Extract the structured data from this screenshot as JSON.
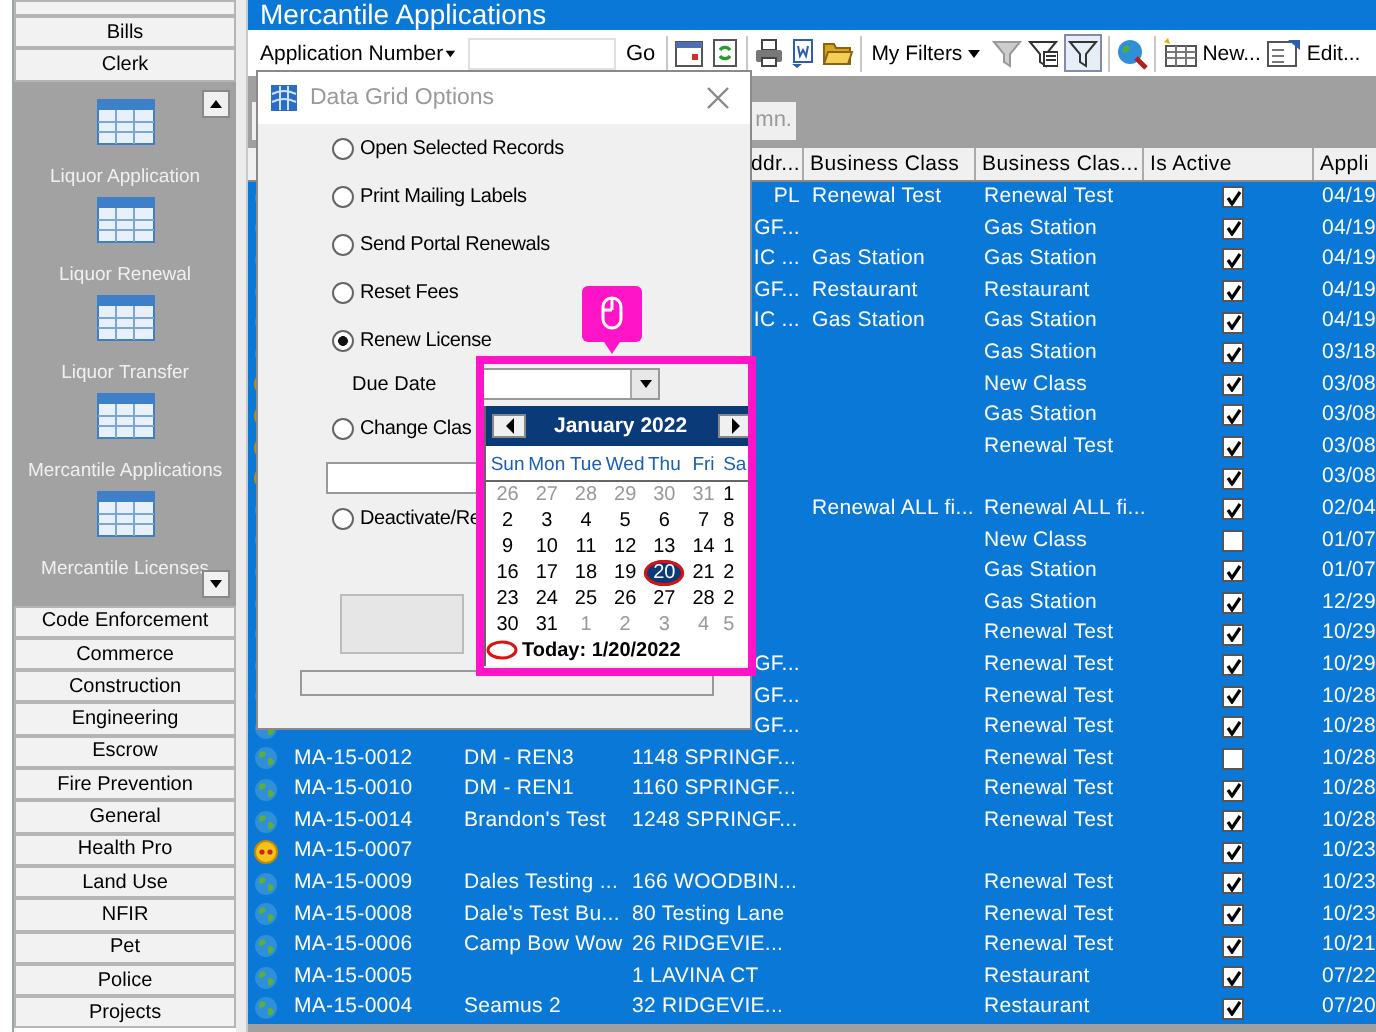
{
  "sidebar": {
    "top_buttons": [
      "Bills",
      "Clerk"
    ],
    "panel_items": [
      {
        "label": "Liquor Application"
      },
      {
        "label": "Liquor Renewal"
      },
      {
        "label": "Liquor Transfer"
      },
      {
        "label": "Mercantile Applications"
      },
      {
        "label": "Mercantile Licenses"
      }
    ],
    "bottom_buttons": [
      "Code Enforcement",
      "Commerce",
      "Construction",
      "Engineering",
      "Escrow",
      "Fire Prevention",
      "General",
      "Health Pro",
      "Land Use",
      "NFIR",
      "Pet",
      "Police",
      "Projects"
    ]
  },
  "title": "Mercantile Applications",
  "toolbar": {
    "field_selector": "Application Number",
    "go": "Go",
    "filters": "My Filters",
    "new": "New...",
    "edit": "Edit..."
  },
  "grid": {
    "group_panel": "mn.",
    "columns": [
      "ddr...",
      "Business Class",
      "Business Clas...",
      "Is Active",
      "Appli"
    ],
    "rows": [
      {
        "kind": "globe",
        "selected": true,
        "address": "PL",
        "class": "Renewal Test",
        "class_2": "Renewal Test",
        "active": true,
        "applied": "04/19"
      },
      {
        "kind": "globe",
        "selected": true,
        "address": "GF...",
        "class_2": "Gas Station",
        "active": true,
        "applied": "04/19"
      },
      {
        "kind": "globe",
        "selected": true,
        "address": "IC ...",
        "class": "Gas Station",
        "class_2": "Gas Station",
        "active": true,
        "applied": "04/19"
      },
      {
        "kind": "globe",
        "selected": true,
        "address": "GF...",
        "class": "Restaurant",
        "class_2": "Restaurant",
        "active": true,
        "applied": "04/19"
      },
      {
        "kind": "globe",
        "selected": true,
        "address": "IC ...",
        "class": "Gas Station",
        "class_2": "Gas Station",
        "active": true,
        "applied": "04/19"
      },
      {
        "kind": "globe",
        "selected": true,
        "class_2": "Gas Station",
        "active": true,
        "applied": "03/18"
      },
      {
        "kind": "alert",
        "selected": true,
        "class_2": "New Class",
        "active": true,
        "applied": "03/08"
      },
      {
        "kind": "alert",
        "selected": true,
        "class_2": "Gas Station",
        "active": true,
        "applied": "03/08"
      },
      {
        "kind": "alert",
        "selected": true,
        "class_2": "Renewal Test",
        "active": true,
        "applied": "03/08"
      },
      {
        "kind": "alert",
        "selected": true,
        "active": true,
        "applied": "03/08"
      },
      {
        "kind": "globe",
        "selected": true,
        "class": "Renewal ALL fi...",
        "class_2": "Renewal ALL fi...",
        "active": true,
        "applied": "02/04"
      },
      {
        "kind": "globe",
        "selected": true,
        "class_2": "New Class",
        "active": false,
        "applied": "01/07"
      },
      {
        "kind": "globe",
        "selected": true,
        "class_2": "Gas Station",
        "active": true,
        "applied": "01/07"
      },
      {
        "kind": "globe",
        "selected": true,
        "class_2": "Gas Station",
        "active": true,
        "applied": "12/29"
      },
      {
        "kind": "globe",
        "selected": true,
        "class_2": "Renewal Test",
        "active": true,
        "applied": "10/29"
      },
      {
        "kind": "globe",
        "selected": true,
        "address": "GF...",
        "class_2": "Renewal Test",
        "active": true,
        "applied": "10/29"
      },
      {
        "kind": "globe",
        "selected": true,
        "address": "GF...",
        "class_2": "Renewal Test",
        "active": true,
        "applied": "10/28"
      },
      {
        "kind": "globe",
        "selected": true,
        "address": "GF...",
        "class_2": "Renewal Test",
        "active": true,
        "applied": "10/28"
      },
      {
        "kind": "globe",
        "selected": true,
        "app_number": "MA-15-0012",
        "name": "DM - REN3",
        "address": "1148 SPRINGF...",
        "class_2": "Renewal Test",
        "active": false,
        "applied": "10/28"
      },
      {
        "kind": "globe",
        "selected": true,
        "app_number": "MA-15-0010",
        "name": "DM - REN1",
        "address": "1160 SPRINGF...",
        "class_2": "Renewal Test",
        "active": true,
        "applied": "10/28"
      },
      {
        "kind": "globe",
        "selected": true,
        "app_number": "MA-15-0014",
        "name": "Brandon's Test",
        "address": "1248 SPRINGF...",
        "class_2": "Renewal Test",
        "active": true,
        "applied": "10/28"
      },
      {
        "kind": "alert",
        "selected": true,
        "app_number": "MA-15-0007",
        "active": true,
        "applied": "10/23"
      },
      {
        "kind": "globe",
        "selected": true,
        "app_number": "MA-15-0009",
        "name": "Dales Testing ...",
        "address": "166 WOODBIN...",
        "class_2": "Renewal Test",
        "active": true,
        "applied": "10/23"
      },
      {
        "kind": "globe",
        "selected": true,
        "app_number": "MA-15-0008",
        "name": "Dale's Test Bu...",
        "address": "80 Testing Lane",
        "class_2": "Renewal Test",
        "active": true,
        "applied": "10/23"
      },
      {
        "kind": "globe",
        "selected": true,
        "app_number": "MA-15-0006",
        "name": "Camp Bow Wow",
        "address": "26 RIDGEVIE...",
        "class_2": "Renewal Test",
        "active": true,
        "applied": "10/21"
      },
      {
        "kind": "globe",
        "selected": true,
        "app_number": "MA-15-0005",
        "address": "1 LAVINA CT",
        "class_2": "Restaurant",
        "active": true,
        "applied": "07/22"
      },
      {
        "kind": "globe",
        "selected": true,
        "app_number": "MA-15-0004",
        "name": "Seamus 2",
        "address": "32 RIDGEVIE...",
        "class_2": "Restaurant",
        "active": true,
        "applied": "07/20"
      }
    ]
  },
  "dialog": {
    "title": "Data Grid Options",
    "options": [
      {
        "kind": "radio",
        "label": "Open Selected Records",
        "selected": false
      },
      {
        "kind": "radio",
        "label": "Print Mailing Labels",
        "selected": false
      },
      {
        "kind": "radio",
        "label": "Send Portal Renewals",
        "selected": false
      },
      {
        "kind": "radio",
        "label": "Reset Fees",
        "selected": false
      },
      {
        "kind": "radio",
        "label": "Renew License",
        "selected": true
      },
      {
        "kind": "date",
        "label": "Due Date"
      },
      {
        "kind": "radio",
        "label": "Change Clas",
        "selected": false
      },
      {
        "kind": "text"
      },
      {
        "kind": "radio",
        "label": "Deactivate/Re",
        "selected": false
      },
      {
        "kind": "button"
      },
      {
        "kind": "status"
      }
    ]
  },
  "calendar": {
    "month": "January 2022",
    "weekdays": [
      "Sun",
      "Mon",
      "Tue",
      "Wed",
      "Thu",
      "Fri",
      "Sa"
    ],
    "weeks": [
      [
        {
          "day": "26",
          "other_month": true,
          "selected": false,
          "today": false
        },
        {
          "day": "27",
          "other_month": true,
          "selected": false,
          "today": false
        },
        {
          "day": "28",
          "other_month": true,
          "selected": false,
          "today": false
        },
        {
          "day": "29",
          "other_month": true,
          "selected": false,
          "today": false
        },
        {
          "day": "30",
          "other_month": true,
          "selected": false,
          "today": false
        },
        {
          "day": "31",
          "other_month": true,
          "selected": false,
          "today": false
        },
        {
          "day": "1",
          "other_month": false,
          "selected": false,
          "today": false
        }
      ],
      [
        {
          "day": "2",
          "other_month": false,
          "selected": false,
          "today": false
        },
        {
          "day": "3",
          "other_month": false,
          "selected": false,
          "today": false
        },
        {
          "day": "4",
          "other_month": false,
          "selected": false,
          "today": false
        },
        {
          "day": "5",
          "other_month": false,
          "selected": false,
          "today": false
        },
        {
          "day": "6",
          "other_month": false,
          "selected": false,
          "today": false
        },
        {
          "day": "7",
          "other_month": false,
          "selected": false,
          "today": false
        },
        {
          "day": "8",
          "other_month": false,
          "selected": false,
          "today": false
        }
      ],
      [
        {
          "day": "9",
          "other_month": false,
          "selected": false,
          "today": false
        },
        {
          "day": "10",
          "other_month": false,
          "selected": false,
          "today": false
        },
        {
          "day": "11",
          "other_month": false,
          "selected": false,
          "today": false
        },
        {
          "day": "12",
          "other_month": false,
          "selected": false,
          "today": false
        },
        {
          "day": "13",
          "other_month": false,
          "selected": false,
          "today": false
        },
        {
          "day": "14",
          "other_month": false,
          "selected": false,
          "today": false
        },
        {
          "day": "1",
          "other_month": false,
          "selected": false,
          "today": false
        }
      ],
      [
        {
          "day": "16",
          "other_month": false,
          "selected": false,
          "today": false
        },
        {
          "day": "17",
          "other_month": false,
          "selected": false,
          "today": false
        },
        {
          "day": "18",
          "other_month": false,
          "selected": false,
          "today": false
        },
        {
          "day": "19",
          "other_month": false,
          "selected": false,
          "today": false
        },
        {
          "day": "20",
          "other_month": false,
          "selected": true,
          "today": true
        },
        {
          "day": "21",
          "other_month": false,
          "selected": false,
          "today": false
        },
        {
          "day": "2",
          "other_month": false,
          "selected": false,
          "today": false
        }
      ],
      [
        {
          "day": "23",
          "other_month": false,
          "selected": false,
          "today": false
        },
        {
          "day": "24",
          "other_month": false,
          "selected": false,
          "today": false
        },
        {
          "day": "25",
          "other_month": false,
          "selected": false,
          "today": false
        },
        {
          "day": "26",
          "other_month": false,
          "selected": false,
          "today": false
        },
        {
          "day": "27",
          "other_month": false,
          "selected": false,
          "today": false
        },
        {
          "day": "28",
          "other_month": false,
          "selected": false,
          "today": false
        },
        {
          "day": "2",
          "other_month": false,
          "selected": false,
          "today": false
        }
      ],
      [
        {
          "day": "30",
          "other_month": false,
          "selected": false,
          "today": false
        },
        {
          "day": "31",
          "other_month": false,
          "selected": false,
          "today": false
        },
        {
          "day": "1",
          "other_month": true,
          "selected": false,
          "today": false
        },
        {
          "day": "2",
          "other_month": true,
          "selected": false,
          "today": false
        },
        {
          "day": "3",
          "other_month": true,
          "selected": false,
          "today": false
        },
        {
          "day": "4",
          "other_month": true,
          "selected": false,
          "today": false
        },
        {
          "day": "5",
          "other_month": true,
          "selected": false,
          "today": false
        }
      ]
    ],
    "today_label": "Today: 1/20/2022"
  }
}
